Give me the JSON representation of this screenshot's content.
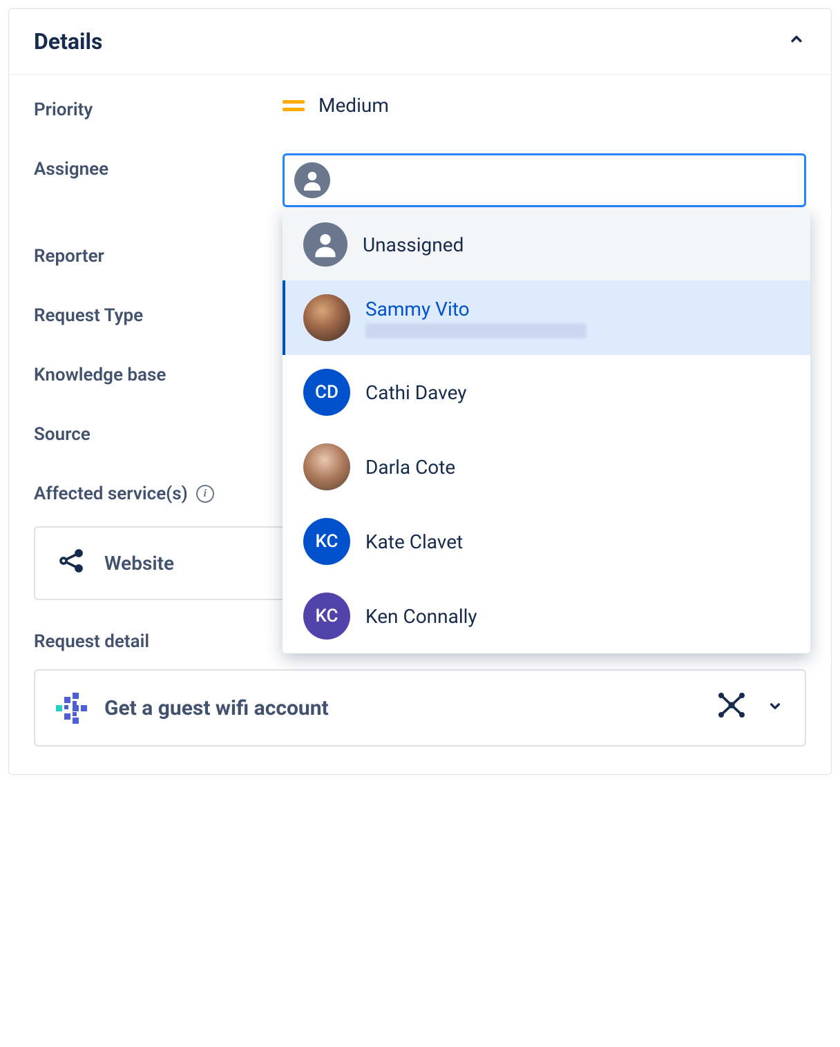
{
  "panel": {
    "title": "Details"
  },
  "fields": {
    "priority": {
      "label": "Priority",
      "value": "Medium"
    },
    "assignee": {
      "label": "Assignee"
    },
    "reporter": {
      "label": "Reporter"
    },
    "requestType": {
      "label": "Request Type"
    },
    "knowledgeBase": {
      "label": "Knowledge base"
    },
    "source": {
      "label": "Source"
    },
    "affectedServices": {
      "label": "Affected service(s)"
    }
  },
  "assigneeDropdown": {
    "options": [
      {
        "name": "Unassigned",
        "avatarType": "generic",
        "initials": "",
        "state": "gray"
      },
      {
        "name": "Sammy Vito",
        "avatarType": "photo1",
        "initials": "",
        "state": "selected",
        "hasSubtext": true
      },
      {
        "name": "Cathi Davey",
        "avatarType": "initials",
        "initials": "CD",
        "color": "blue"
      },
      {
        "name": "Darla Cote",
        "avatarType": "photo2",
        "initials": ""
      },
      {
        "name": "Kate Clavet",
        "avatarType": "initials",
        "initials": "KC",
        "color": "blue"
      },
      {
        "name": "Ken Connally",
        "avatarType": "initials",
        "initials": "KC",
        "color": "purple"
      }
    ]
  },
  "service": {
    "name": "Website"
  },
  "requestDetail": {
    "sectionTitle": "Request detail",
    "item": "Get a guest wifi account"
  }
}
